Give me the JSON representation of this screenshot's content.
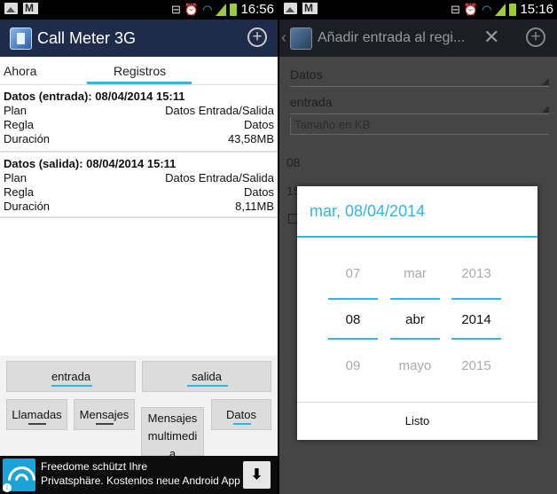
{
  "left": {
    "status": {
      "time": "16:56"
    },
    "app_title": "Call Meter 3G",
    "tabs": [
      "Ahora",
      "Registros"
    ],
    "entries": [
      {
        "title": "Datos (entrada): 08/04/2014 15:11",
        "rows": [
          {
            "label": "Plan",
            "value": "Datos Entrada/Salida"
          },
          {
            "label": "Regla",
            "value": "Datos"
          },
          {
            "label": "Duración",
            "value": "43,58MB"
          }
        ]
      },
      {
        "title": "Datos (salida): 08/04/2014 15:11",
        "rows": [
          {
            "label": "Plan",
            "value": "Datos Entrada/Salida"
          },
          {
            "label": "Regla",
            "value": "Datos"
          },
          {
            "label": "Duración",
            "value": "8,11MB"
          }
        ]
      }
    ],
    "buttons": {
      "entrada": "entrada",
      "salida": "salida",
      "llamadas": "Llamadas",
      "mensajes": "Mensajes",
      "mms_line1": "Mensajes",
      "mms_line2": "multimedi",
      "mms_line3": "a",
      "datos": "Datos"
    },
    "ad": {
      "line1": "Freedome schützt Ihre",
      "line2": "Privatsphäre. Kostenlos neue Android App"
    }
  },
  "right": {
    "status": {
      "time": "15:16"
    },
    "title": "Añadir entrada al regi...",
    "form": {
      "spinner1": "Datos",
      "spinner2": "entrada",
      "input_placeholder": "Tamaño en KB",
      "stub1": "08",
      "stub2": "15"
    },
    "dialog": {
      "title": "mar, 08/04/2014",
      "day": {
        "prev": "07",
        "current": "08",
        "next": "09"
      },
      "month": {
        "prev": "mar",
        "current": "abr",
        "next": "mayo"
      },
      "year": {
        "prev": "2013",
        "current": "2014",
        "next": "2015"
      },
      "button": "Listo"
    }
  },
  "colors": {
    "accent": "#33b5e5",
    "actionbar_left": "#1f2b4a",
    "actionbar_right": "#1b1e25"
  }
}
